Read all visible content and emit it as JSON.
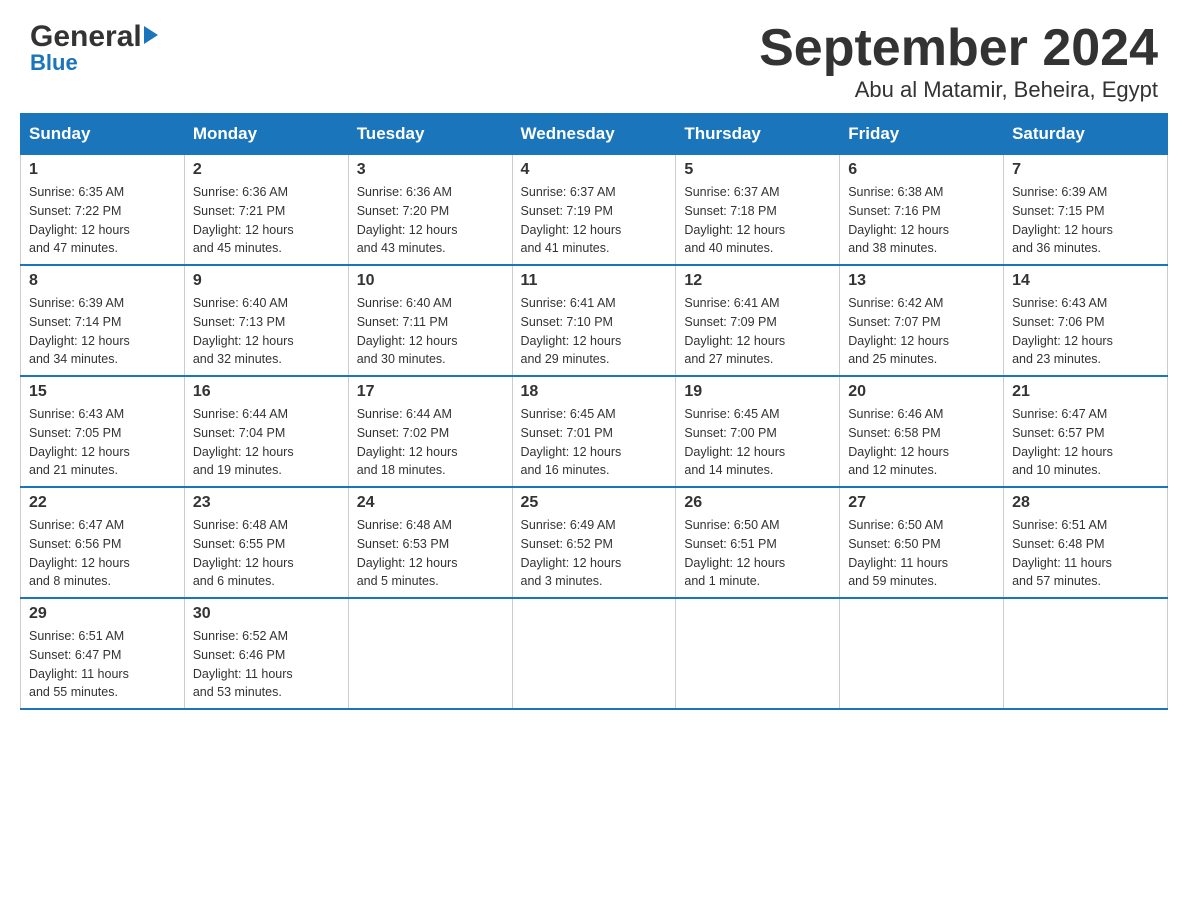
{
  "header": {
    "logo_line1": "General",
    "logo_line2": "Blue",
    "title": "September 2024",
    "subtitle": "Abu al Matamir, Beheira, Egypt"
  },
  "calendar": {
    "days_of_week": [
      "Sunday",
      "Monday",
      "Tuesday",
      "Wednesday",
      "Thursday",
      "Friday",
      "Saturday"
    ],
    "weeks": [
      [
        {
          "num": "1",
          "sunrise": "6:35 AM",
          "sunset": "7:22 PM",
          "daylight": "12 hours and 47 minutes."
        },
        {
          "num": "2",
          "sunrise": "6:36 AM",
          "sunset": "7:21 PM",
          "daylight": "12 hours and 45 minutes."
        },
        {
          "num": "3",
          "sunrise": "6:36 AM",
          "sunset": "7:20 PM",
          "daylight": "12 hours and 43 minutes."
        },
        {
          "num": "4",
          "sunrise": "6:37 AM",
          "sunset": "7:19 PM",
          "daylight": "12 hours and 41 minutes."
        },
        {
          "num": "5",
          "sunrise": "6:37 AM",
          "sunset": "7:18 PM",
          "daylight": "12 hours and 40 minutes."
        },
        {
          "num": "6",
          "sunrise": "6:38 AM",
          "sunset": "7:16 PM",
          "daylight": "12 hours and 38 minutes."
        },
        {
          "num": "7",
          "sunrise": "6:39 AM",
          "sunset": "7:15 PM",
          "daylight": "12 hours and 36 minutes."
        }
      ],
      [
        {
          "num": "8",
          "sunrise": "6:39 AM",
          "sunset": "7:14 PM",
          "daylight": "12 hours and 34 minutes."
        },
        {
          "num": "9",
          "sunrise": "6:40 AM",
          "sunset": "7:13 PM",
          "daylight": "12 hours and 32 minutes."
        },
        {
          "num": "10",
          "sunrise": "6:40 AM",
          "sunset": "7:11 PM",
          "daylight": "12 hours and 30 minutes."
        },
        {
          "num": "11",
          "sunrise": "6:41 AM",
          "sunset": "7:10 PM",
          "daylight": "12 hours and 29 minutes."
        },
        {
          "num": "12",
          "sunrise": "6:41 AM",
          "sunset": "7:09 PM",
          "daylight": "12 hours and 27 minutes."
        },
        {
          "num": "13",
          "sunrise": "6:42 AM",
          "sunset": "7:07 PM",
          "daylight": "12 hours and 25 minutes."
        },
        {
          "num": "14",
          "sunrise": "6:43 AM",
          "sunset": "7:06 PM",
          "daylight": "12 hours and 23 minutes."
        }
      ],
      [
        {
          "num": "15",
          "sunrise": "6:43 AM",
          "sunset": "7:05 PM",
          "daylight": "12 hours and 21 minutes."
        },
        {
          "num": "16",
          "sunrise": "6:44 AM",
          "sunset": "7:04 PM",
          "daylight": "12 hours and 19 minutes."
        },
        {
          "num": "17",
          "sunrise": "6:44 AM",
          "sunset": "7:02 PM",
          "daylight": "12 hours and 18 minutes."
        },
        {
          "num": "18",
          "sunrise": "6:45 AM",
          "sunset": "7:01 PM",
          "daylight": "12 hours and 16 minutes."
        },
        {
          "num": "19",
          "sunrise": "6:45 AM",
          "sunset": "7:00 PM",
          "daylight": "12 hours and 14 minutes."
        },
        {
          "num": "20",
          "sunrise": "6:46 AM",
          "sunset": "6:58 PM",
          "daylight": "12 hours and 12 minutes."
        },
        {
          "num": "21",
          "sunrise": "6:47 AM",
          "sunset": "6:57 PM",
          "daylight": "12 hours and 10 minutes."
        }
      ],
      [
        {
          "num": "22",
          "sunrise": "6:47 AM",
          "sunset": "6:56 PM",
          "daylight": "12 hours and 8 minutes."
        },
        {
          "num": "23",
          "sunrise": "6:48 AM",
          "sunset": "6:55 PM",
          "daylight": "12 hours and 6 minutes."
        },
        {
          "num": "24",
          "sunrise": "6:48 AM",
          "sunset": "6:53 PM",
          "daylight": "12 hours and 5 minutes."
        },
        {
          "num": "25",
          "sunrise": "6:49 AM",
          "sunset": "6:52 PM",
          "daylight": "12 hours and 3 minutes."
        },
        {
          "num": "26",
          "sunrise": "6:50 AM",
          "sunset": "6:51 PM",
          "daylight": "12 hours and 1 minute."
        },
        {
          "num": "27",
          "sunrise": "6:50 AM",
          "sunset": "6:50 PM",
          "daylight": "11 hours and 59 minutes."
        },
        {
          "num": "28",
          "sunrise": "6:51 AM",
          "sunset": "6:48 PM",
          "daylight": "11 hours and 57 minutes."
        }
      ],
      [
        {
          "num": "29",
          "sunrise": "6:51 AM",
          "sunset": "6:47 PM",
          "daylight": "11 hours and 55 minutes."
        },
        {
          "num": "30",
          "sunrise": "6:52 AM",
          "sunset": "6:46 PM",
          "daylight": "11 hours and 53 minutes."
        },
        null,
        null,
        null,
        null,
        null
      ]
    ],
    "labels": {
      "sunrise": "Sunrise:",
      "sunset": "Sunset:",
      "daylight": "Daylight:"
    }
  }
}
